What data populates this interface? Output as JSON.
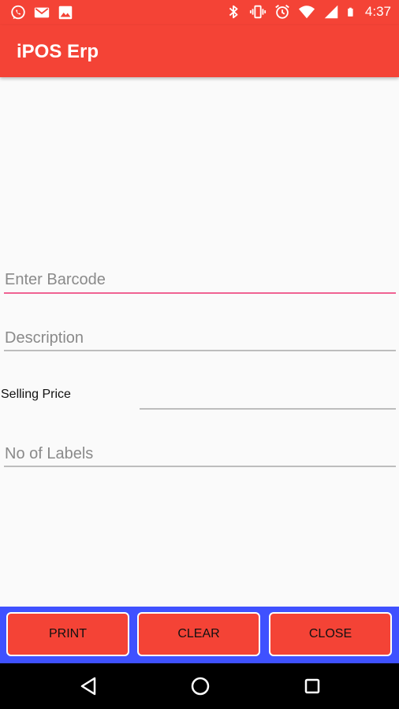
{
  "status_bar": {
    "time": "4:37",
    "left_icons": [
      "whatsapp-icon",
      "gmail-icon",
      "image-icon"
    ],
    "right_icons": [
      "bluetooth-icon",
      "vibrate-icon",
      "alarm-icon",
      "wifi-icon",
      "signal-icon",
      "battery-icon"
    ]
  },
  "app_bar": {
    "title": "iPOS Erp",
    "color": "#f44336"
  },
  "form": {
    "barcode": {
      "placeholder": "Enter Barcode",
      "value": ""
    },
    "description": {
      "placeholder": "Description",
      "value": ""
    },
    "selling_price": {
      "label": "Selling Price",
      "value": ""
    },
    "no_of_labels": {
      "placeholder": "No of Labels",
      "value": ""
    }
  },
  "buttons": {
    "print": "PRINT",
    "clear": "CLEAR",
    "close": "CLOSE",
    "bar_color": "#3f51ff"
  },
  "nav_bar": {
    "icons": [
      "back-icon",
      "home-icon",
      "recents-icon"
    ]
  }
}
